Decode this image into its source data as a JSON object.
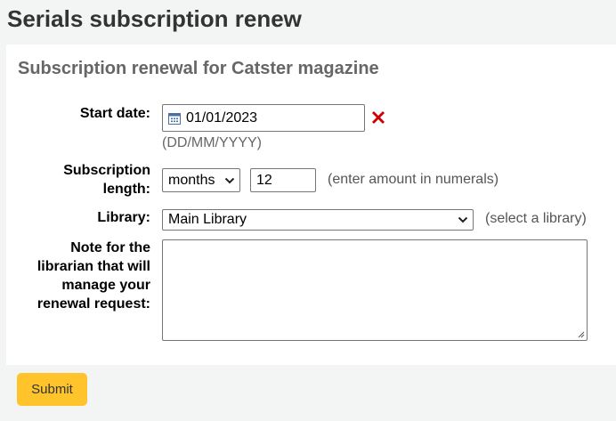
{
  "page": {
    "title": "Serials subscription renew"
  },
  "panel": {
    "title": "Subscription renewal for Catster magazine"
  },
  "form": {
    "start_date": {
      "label": "Start date:",
      "value": "01/01/2023",
      "format_hint": "(DD/MM/YYYY)",
      "calendar_icon": "calendar-icon",
      "clear_icon": "clear-x-icon",
      "clear_color": "#cc0000"
    },
    "subscription_length": {
      "label_line1": "Subscription",
      "label_line2": "length:",
      "unit": "months",
      "amount": "12",
      "hint": "(enter amount in numerals)"
    },
    "library": {
      "label": "Library:",
      "selected": "Main Library",
      "hint": "(select a library)"
    },
    "note": {
      "label_line1": "Note for the",
      "label_line2": "librarian that will",
      "label_line3": "manage your",
      "label_line4": "renewal request:",
      "value": ""
    }
  },
  "actions": {
    "submit_label": "Submit",
    "submit_color": "#ffc32b"
  }
}
